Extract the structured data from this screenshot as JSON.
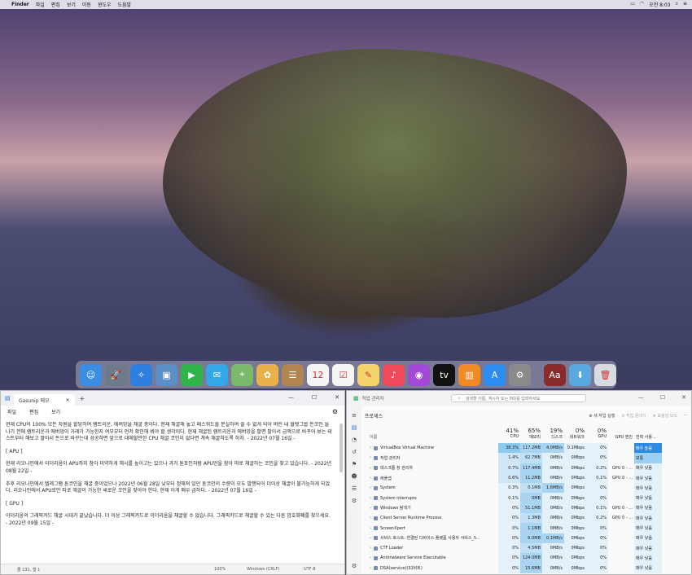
{
  "menubar": {
    "apple": "",
    "items": [
      "Finder",
      "파일",
      "편집",
      "보기",
      "이동",
      "윈도우",
      "도움말"
    ],
    "clock": "오전 8:03"
  },
  "dock": {
    "icons": [
      {
        "name": "finder-icon",
        "color": "#3a8de0",
        "glyph": "☺"
      },
      {
        "name": "launchpad-icon",
        "color": "#6c7a8c",
        "glyph": "🚀"
      },
      {
        "name": "safari-icon",
        "color": "#2f7fe0",
        "glyph": "✧"
      },
      {
        "name": "preview-icon",
        "color": "#5b8fc7",
        "glyph": "▣"
      },
      {
        "name": "facetime-icon",
        "color": "#2fb54a",
        "glyph": "▶"
      },
      {
        "name": "messages-icon",
        "color": "#34a7e8",
        "glyph": "✉"
      },
      {
        "name": "maps-icon",
        "color": "#7cb86a",
        "glyph": "⌖"
      },
      {
        "name": "photos-icon",
        "color": "#e8b24a",
        "glyph": "✿"
      },
      {
        "name": "contacts-icon",
        "color": "#b08550",
        "glyph": "☰"
      },
      {
        "name": "calendar-icon",
        "color": "#f5f5f5",
        "glyph": "12"
      },
      {
        "name": "reminders-icon",
        "color": "#f5f5f5",
        "glyph": "☑"
      },
      {
        "name": "notes-icon",
        "color": "#f2d46a",
        "glyph": "✎"
      },
      {
        "name": "music-icon",
        "color": "#f04a5a",
        "glyph": "♪"
      },
      {
        "name": "podcasts-icon",
        "color": "#a24ad6",
        "glyph": "◉"
      },
      {
        "name": "tv-icon",
        "color": "#111111",
        "glyph": "tv"
      },
      {
        "name": "books-icon",
        "color": "#f08a24",
        "glyph": "▥"
      },
      {
        "name": "app-store-icon",
        "color": "#2d8cf0",
        "glyph": "A"
      },
      {
        "name": "system-preferences-icon",
        "color": "#8a8a8a",
        "glyph": "⚙"
      },
      {
        "name": "dictionary-icon",
        "color": "#8a2b2b",
        "glyph": "Aa"
      },
      {
        "name": "downloads-icon",
        "color": "#5aa8e0",
        "glyph": "⬇"
      },
      {
        "name": "trash-icon",
        "color": "#d8dce2",
        "glyph": "🗑"
      }
    ],
    "calendar_day": "12"
  },
  "notepad": {
    "tab_title": "Gasunip 메모",
    "menu": [
      "파일",
      "편집",
      "보기"
    ],
    "paragraphs": [
      "현재 CPU의 100% 모든 자원을 할당하여 램트리운, 에버앙을 채굴 중이다. 현재 채굴해 놓고 패스워드를 분실하여 쓸 수 없게 되어 버린 내 월렛그룹 돈코인 을 나기 전에 램트리운과 에버앙이 거래가 가능한지 여부부터 먼저 확인해 봐야 할 생각이다. 현재 채굴된 램트리운과 에버앙을 팔면 팔아서 금액으로 바꾸어 보는 테스트부터 해보고 팔아서 돈으로 바꾸는데 성공하면 앞으로 대체할만한 CPU 채굴 코인이 없다면 계속 채굴하도록 하자.  - 2022년 07월 16일 -",
      "[ APU ]",
      "현재 리오나인에서 이더리움이 APU까지 참아 미약하게 해시를 높이고는 있으나 과거 톤포인처럼 APU만을 참아 따로 채굴하는 코인을 찾고 있습니다.  - 2022년 08월 22일 -",
      "추후 리오나인에서 텔레그램 톤코인을 채굴 중이었으나 2022년 06월 28일 낮부터 정해져 있던 톤코인의 수량이 모두 발행되어 더이상 채굴이 불가능하게 되었다. 리오나인에서 APU로만 따로 채굴이 가능한 새로운 코인을 찾아야 한다. 현재 이게 매우 급하다.  - 2022년 07월 16일 -",
      "[ GPU ]",
      "이더리움의 그래픽카드 채굴 시대가 끝났습니다. 더 이상 그래픽카드로 이더리움을 채굴할 수 없습니다. 그래픽카드로 채굴할 수 있는 다른 암호화폐를 찾으세요.  - 2022년 09월 15일 -"
    ],
    "status": {
      "pos": "줄 131, 열 1",
      "zoom": "100%",
      "eol": "Windows (CRLF)",
      "enc": "UTF-8"
    }
  },
  "taskmgr": {
    "title": "작업 관리자",
    "search_placeholder": "검색할 이름, 게시자 또는 PID를 입력하세요.",
    "section": "프로세스",
    "run_task": "새 작업 실행",
    "end_task": "작업 끝내기",
    "efficiency": "효율성 모드",
    "columns": {
      "name": "이름",
      "cpu": {
        "pct": "41%",
        "label": "CPU"
      },
      "mem": {
        "pct": "65%",
        "label": "메모리"
      },
      "disk": {
        "pct": "19%",
        "label": "디스크"
      },
      "net": {
        "pct": "0%",
        "label": "네트워크"
      },
      "gpu": {
        "pct": "0%",
        "label": "GPU"
      },
      "gpu_engine": "GPU 엔진",
      "power": "전력 사용..."
    },
    "rows": [
      {
        "name": "VirtualBox Virtual Machine",
        "cpu": "38.3%",
        "mem": "117.2MB",
        "disk": "4.0MB/s",
        "net": "0.1Mbps",
        "gpu": "0%",
        "eng": "",
        "power": "매우 높음",
        "hot": true
      },
      {
        "name": "작업 관리자",
        "cpu": "1.4%",
        "mem": "62.7MB",
        "disk": "0MB/s",
        "net": "0Mbps",
        "gpu": "0%",
        "eng": "",
        "power": "보통",
        "hot": false
      },
      {
        "name": "데스크톱 창 관리자",
        "cpu": "0.7%",
        "mem": "117.4MB",
        "disk": "0MB/s",
        "net": "0Mbps",
        "gpu": "0.2%",
        "eng": "GPU 0 - ...",
        "power": "매우 낮음",
        "hot": false
      },
      {
        "name": "애플앱",
        "cpu": "0.6%",
        "mem": "11.2MB",
        "disk": "0MB/s",
        "net": "0Mbps",
        "gpu": "0.1%",
        "eng": "GPU 0 - ...",
        "power": "매우 낮음",
        "hot": false
      },
      {
        "name": "System",
        "cpu": "0.3%",
        "mem": "0.1MB",
        "disk": "1.6MB/s",
        "net": "0Mbps",
        "gpu": "0%",
        "eng": "",
        "power": "매우 낮음",
        "hot": false
      },
      {
        "name": "System interrupts",
        "cpu": "0.1%",
        "mem": "0MB",
        "disk": "0MB/s",
        "net": "0Mbps",
        "gpu": "0%",
        "eng": "",
        "power": "매우 낮음",
        "hot": false
      },
      {
        "name": "Windows 탐색기",
        "cpu": "0%",
        "mem": "51.1MB",
        "disk": "0MB/s",
        "net": "0Mbps",
        "gpu": "0.1%",
        "eng": "GPU 0 - ...",
        "power": "매우 낮음",
        "hot": false
      },
      {
        "name": "Client Server Runtime Process",
        "cpu": "0%",
        "mem": "1.3MB",
        "disk": "0MB/s",
        "net": "0Mbps",
        "gpu": "0.2%",
        "eng": "GPU 0 - ...",
        "power": "매우 낮음",
        "hot": false
      },
      {
        "name": "ScreenXpert",
        "cpu": "0%",
        "mem": "1.1MB",
        "disk": "0MB/s",
        "net": "0Mbps",
        "gpu": "0%",
        "eng": "",
        "power": "매우 낮음",
        "hot": false
      },
      {
        "name": "서비스 호스트: 연결된 디바이스 플랫폼 사용자 서비스_5...",
        "cpu": "0%",
        "mem": "6.0MB",
        "disk": "0.1MB/s",
        "net": "0Mbps",
        "gpu": "0%",
        "eng": "",
        "power": "매우 낮음",
        "hot": false
      },
      {
        "name": "CTF Loader",
        "cpu": "0%",
        "mem": "4.5MB",
        "disk": "0MB/s",
        "net": "0Mbps",
        "gpu": "0%",
        "eng": "",
        "power": "매우 낮음",
        "hot": false
      },
      {
        "name": "Antimalware Service Executable",
        "cpu": "0%",
        "mem": "124.0MB",
        "disk": "0MB/s",
        "net": "0Mbps",
        "gpu": "0%",
        "eng": "",
        "power": "매우 낮음",
        "hot": false
      },
      {
        "name": "DSA(service)(32비트)",
        "cpu": "0%",
        "mem": "15.6MB",
        "disk": "0MB/s",
        "net": "0Mbps",
        "gpu": "0%",
        "eng": "",
        "power": "매우 낮음",
        "hot": false
      }
    ]
  }
}
